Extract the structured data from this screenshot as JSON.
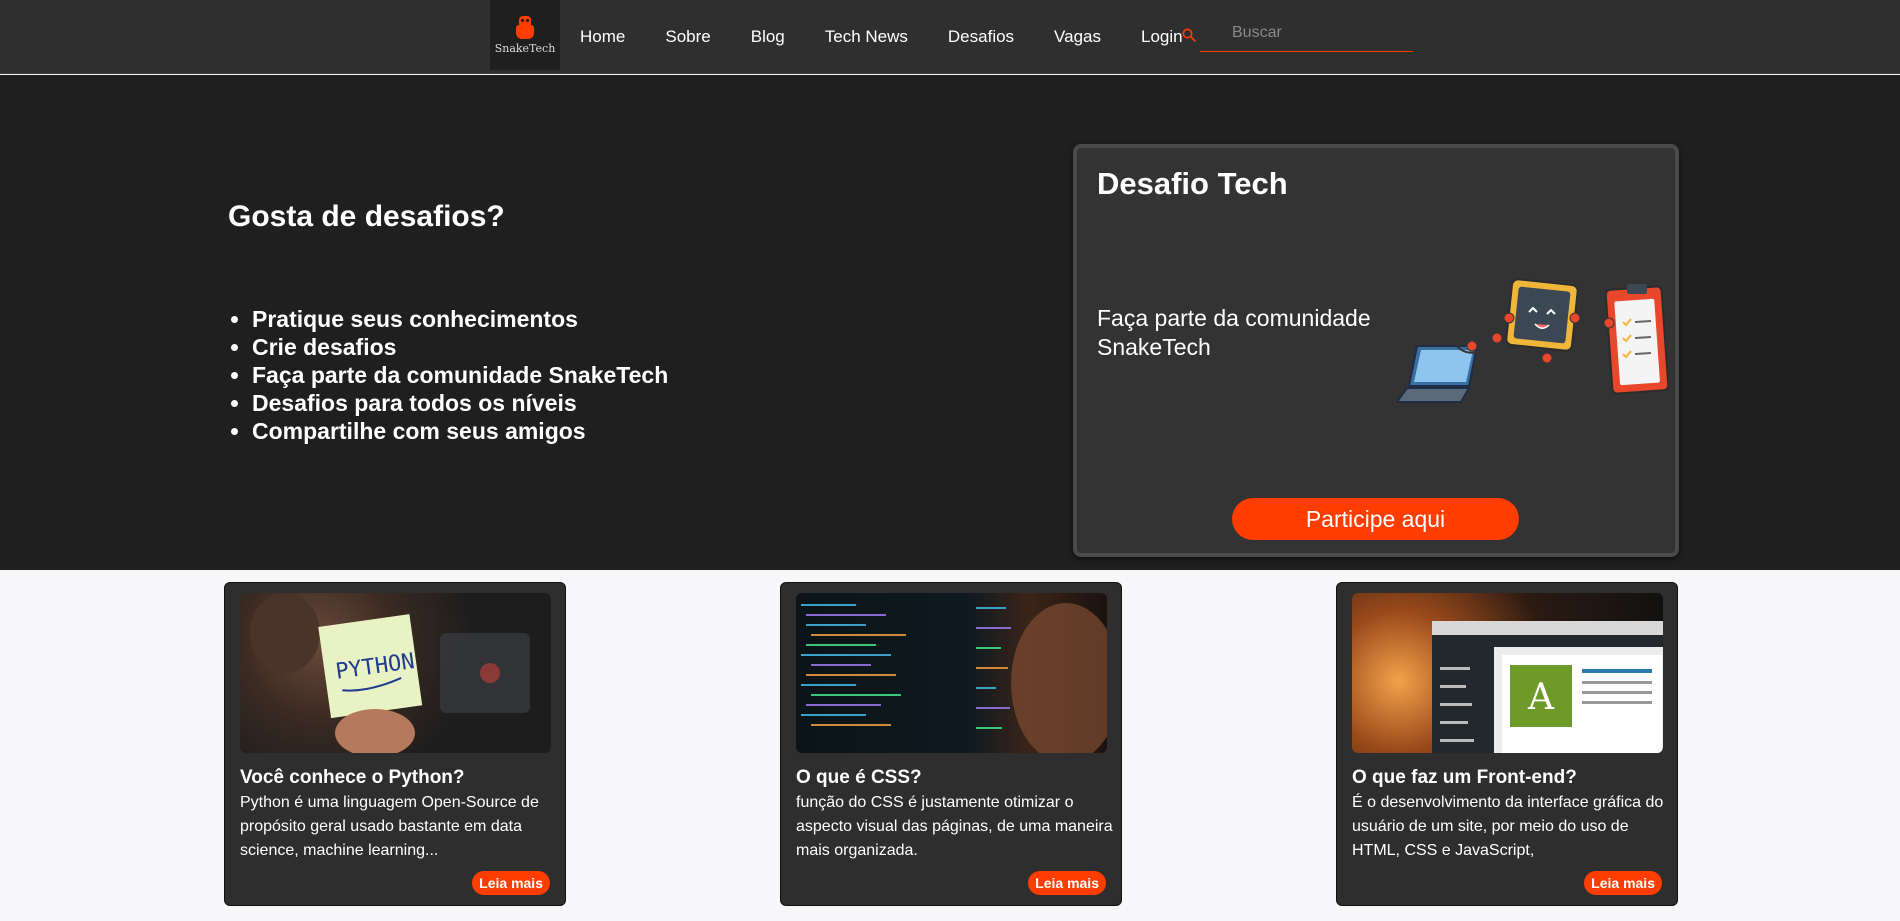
{
  "navbar": {
    "logo_text": "SnakeTech",
    "links": [
      "Home",
      "Sobre",
      "Blog",
      "Tech News",
      "Desafios",
      "Vagas",
      "Login"
    ],
    "search_placeholder": "Buscar",
    "accent_color": "#ff3d00"
  },
  "hero": {
    "title": "Gosta de desafios?",
    "bullets": [
      "Pratique seus conhecimentos",
      "Crie desafios",
      "Faça parte da comunidade SnakeTech",
      "Desafios para todos os níveis",
      "Compartilhe com seus amigos"
    ]
  },
  "challenge_card": {
    "title": "Desafio Tech",
    "text": "Faça parte da comunidade SnakeTech",
    "button_label": "Participe aqui"
  },
  "cards": [
    {
      "title": "Você conhece o Python?",
      "text": "Python é uma linguagem Open-Source de propósito geral usado bastante em data science, machine learning...",
      "image_caption": "PYTHON",
      "button_label": "Leia mais"
    },
    {
      "title": "O que é CSS?",
      "text": "função do CSS é justamente otimizar o aspecto visual das páginas, de uma maneira mais organizada.",
      "button_label": "Leia mais"
    },
    {
      "title": "O que faz um Front-end?",
      "text": "É o desenvolvimento da interface gráfica do usuário de um site, por meio do uso de HTML, CSS e JavaScript,",
      "button_label": "Leia mais"
    }
  ]
}
